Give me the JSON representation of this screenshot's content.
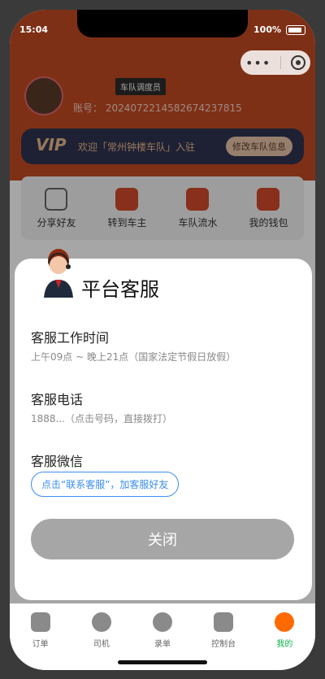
{
  "status": {
    "time": "15:04",
    "battery": "100%"
  },
  "header": {
    "role_badge": "车队调度员",
    "account_label": "账号：",
    "account_value": "20240722145826742378​15",
    "vip_label": "VIP",
    "vip_welcome": "欢迎「常州钟楼车队」入驻",
    "vip_edit_button": "修改车队信息"
  },
  "actions": [
    {
      "label": "分享好友",
      "icon": "share-icon"
    },
    {
      "label": "转到车主",
      "icon": "car-icon"
    },
    {
      "label": "车队流水",
      "icon": "ledger-icon"
    },
    {
      "label": "我的钱包",
      "icon": "wallet-icon"
    }
  ],
  "modal": {
    "title": "平台客服",
    "work_time_title": "客服工作时间",
    "work_time_text": "上午09点 ~ 晚上21点（国家法定节假日放假）",
    "phone_title": "客服电话",
    "phone_text": "1888...（点击号码，直接拨打）",
    "wechat_title": "客服微信",
    "wechat_button": "点击“联系客服”，加客服好友",
    "close_button": "关闭"
  },
  "tabs": [
    {
      "label": "订单",
      "icon": "clipboard-icon"
    },
    {
      "label": "司机",
      "icon": "steering-wheel-icon"
    },
    {
      "label": "录单",
      "icon": "plus-circle-icon"
    },
    {
      "label": "控制台",
      "icon": "dashboard-icon"
    },
    {
      "label": "我的",
      "icon": "user-icon"
    }
  ]
}
